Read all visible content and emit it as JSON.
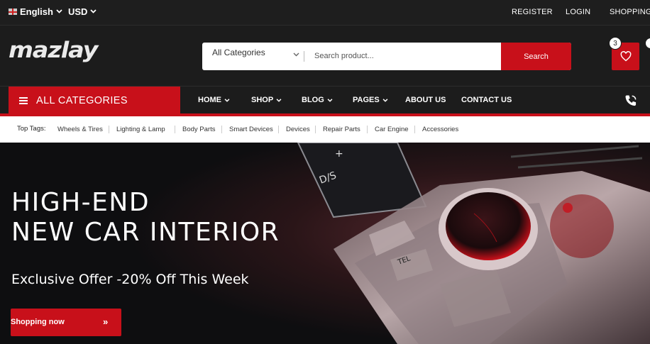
{
  "topbar": {
    "language": "English",
    "currency": "USD",
    "links": [
      "REGISTER",
      "LOGIN",
      "SHOPPING C"
    ]
  },
  "header": {
    "logo": "mazlay",
    "search": {
      "category": "All Categories",
      "placeholder": "Search product...",
      "button": "Search"
    },
    "wishlist_count": "3"
  },
  "nav": {
    "all_categories": "ALL CATEGORIES",
    "items": [
      "HOME",
      "SHOP",
      "BLOG",
      "PAGES",
      "ABOUT US",
      "CONTACT US"
    ]
  },
  "tags": {
    "title": "Top Tags:",
    "items": [
      "Wheels & Tires",
      "Lighting & Lamp",
      "Body Parts",
      "Smart Devices",
      "Devices",
      "Repair Parts",
      "Car Engine",
      "Accessories"
    ]
  },
  "hero": {
    "title_line1": "HIGH-END",
    "title_line2": "NEW CAR INTERIOR",
    "offer": "Exclusive Offer -20% Off This Week",
    "button": "Shopping now",
    "art_labels": [
      "D/S",
      "+",
      "TEL"
    ]
  },
  "colors": {
    "accent": "#c8101a",
    "dark": "#1c1c1c",
    "tagbar": "#ffffff"
  }
}
